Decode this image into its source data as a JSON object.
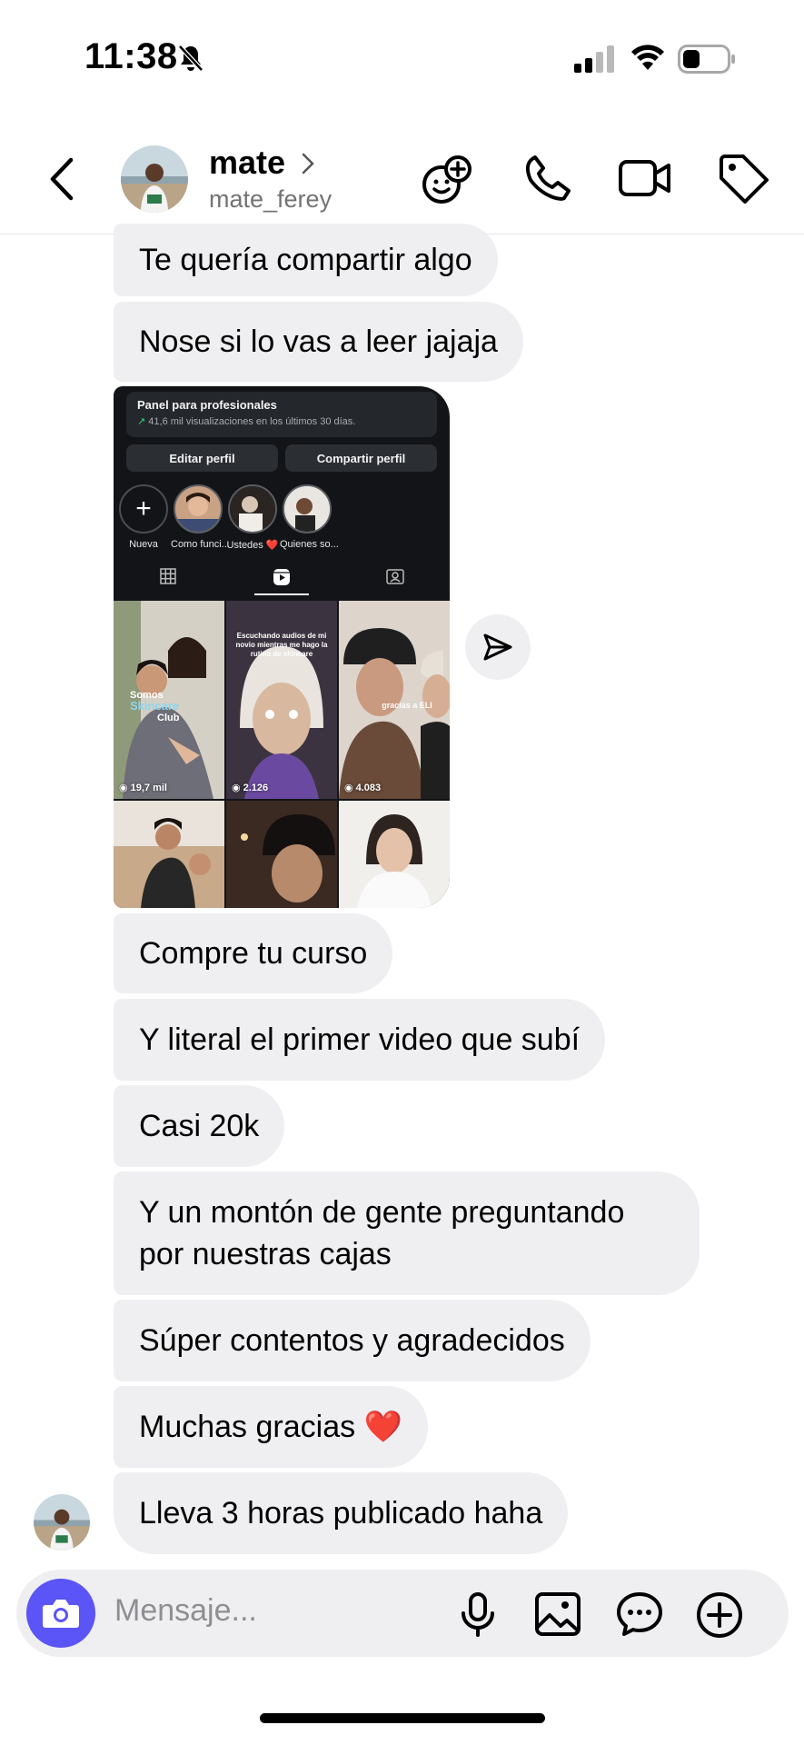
{
  "status_bar": {
    "time": "11:38"
  },
  "header": {
    "name": "mate",
    "username": "mate_ferey"
  },
  "messages": [
    {
      "text": "Te quería compartir algo"
    },
    {
      "text": "Nose si lo vas a leer jajaja"
    },
    {
      "text": "Compre tu curso"
    },
    {
      "text": "Y literal el primer video que subí"
    },
    {
      "text": "Casi 20k"
    },
    {
      "text": "Y un montón de gente preguntando por nuestras cajas"
    },
    {
      "text": "Súper contentos y agradecidos"
    },
    {
      "text": "Muchas gracias ❤️"
    },
    {
      "text": "Lleva 3 horas publicado haha"
    }
  ],
  "shared_post": {
    "panel_title": "Panel para profesionales",
    "panel_subtitle": "41,6 mil visualizaciones en los últimos 30 días.",
    "edit_profile": "Editar perfil",
    "share_profile": "Compartir perfil",
    "highlights": [
      {
        "label": "Nueva"
      },
      {
        "label": "Como funci..."
      },
      {
        "label": "Ustedes ❤️"
      },
      {
        "label": "Quienes so..."
      }
    ],
    "reels": [
      {
        "views": "19,7 mil",
        "caption_line1": "Somos",
        "caption_line2": "Skincare",
        "caption_line3": "Club"
      },
      {
        "views": "2.126",
        "caption": "Escuchando audios de mi novio mientras me hago la rutina de skincare"
      },
      {
        "views": "4.083",
        "caption": "gracias a ELI"
      }
    ]
  },
  "composer": {
    "placeholder": "Mensaje..."
  },
  "colors": {
    "accent": "#5b54f6",
    "bubble": "#efeff1",
    "secondary_text": "#737373"
  }
}
